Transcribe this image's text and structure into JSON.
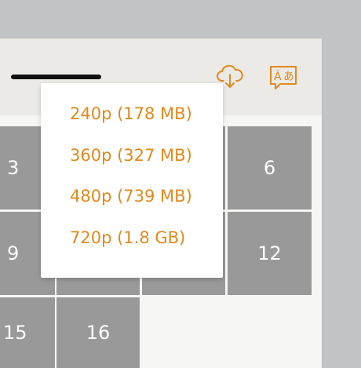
{
  "colors": {
    "accent": "#e08a1e",
    "tile": "#999999",
    "tile_text": "#ffffff",
    "header_bg": "#ebeae6",
    "panel_bg": "#f6f6f4",
    "outer_bg": "#c3c4c6"
  },
  "header": {
    "download_icon": "cloud-download-icon",
    "translate_icon": "translate-icon"
  },
  "quality_menu": {
    "options": [
      {
        "label": "240p (178 MB)"
      },
      {
        "label": "360p (327 MB)"
      },
      {
        "label": "480p (739 MB)"
      },
      {
        "label": "720p (1.8 GB)"
      }
    ]
  },
  "grid": {
    "tiles": [
      {
        "label": "3"
      },
      {
        "label": "6"
      },
      {
        "label": "9"
      },
      {
        "label": "12"
      },
      {
        "label": "15"
      },
      {
        "label": "16"
      }
    ]
  }
}
